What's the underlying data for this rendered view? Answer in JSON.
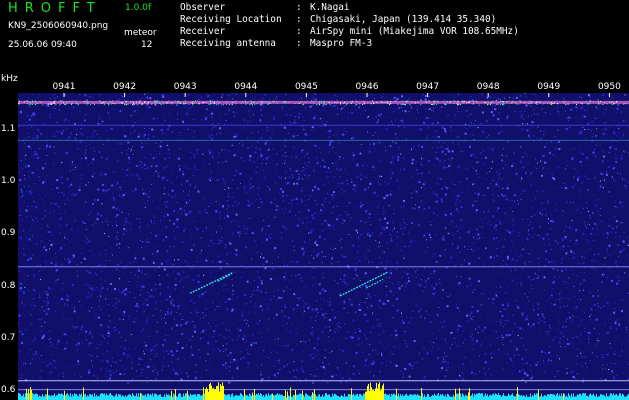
{
  "header": {
    "app_title": "HROFFT",
    "app_version": "1.0.0f",
    "file_name": "KN9_2506060940.png",
    "meteor_label": "meteor",
    "datetime": "25.06.06 09:40",
    "meteor_count": "12"
  },
  "info": [
    {
      "key": "Observer",
      "value": "K.Nagai"
    },
    {
      "key": "Receiving Location",
      "value": "Chigasaki, Japan (139.414 35.340)"
    },
    {
      "key": "Receiver",
      "value": "AirSpy mini (Miakejima VOR 108.65MHz)"
    },
    {
      "key": "Receiving antenna",
      "value": "Maspro FM-3"
    }
  ],
  "info_separator": ":",
  "chart_data": {
    "type": "heatmap",
    "ylabel": "kHz",
    "y_ticks": [
      "1.1",
      "1.0",
      "0.9",
      "0.8",
      "0.7",
      "0.6"
    ],
    "x_ticks": [
      "0941",
      "0942",
      "0943",
      "0944",
      "0945",
      "0946",
      "0947",
      "0948",
      "0949",
      "0950"
    ],
    "ylim": [
      0.58,
      1.17
    ],
    "x_unit": "hhmm",
    "colors": {
      "background": "#000000",
      "plot_background": "#10106a",
      "noise": "#2a2ad0",
      "carrier_line": "#c060c0",
      "reference_line": "#8b8bff",
      "echo": "#30e0e0",
      "signal_strength": "#20e0ff",
      "signal_peak": "#ffff00",
      "axis_text": "#ffffff",
      "title_green": "#19e619"
    }
  }
}
